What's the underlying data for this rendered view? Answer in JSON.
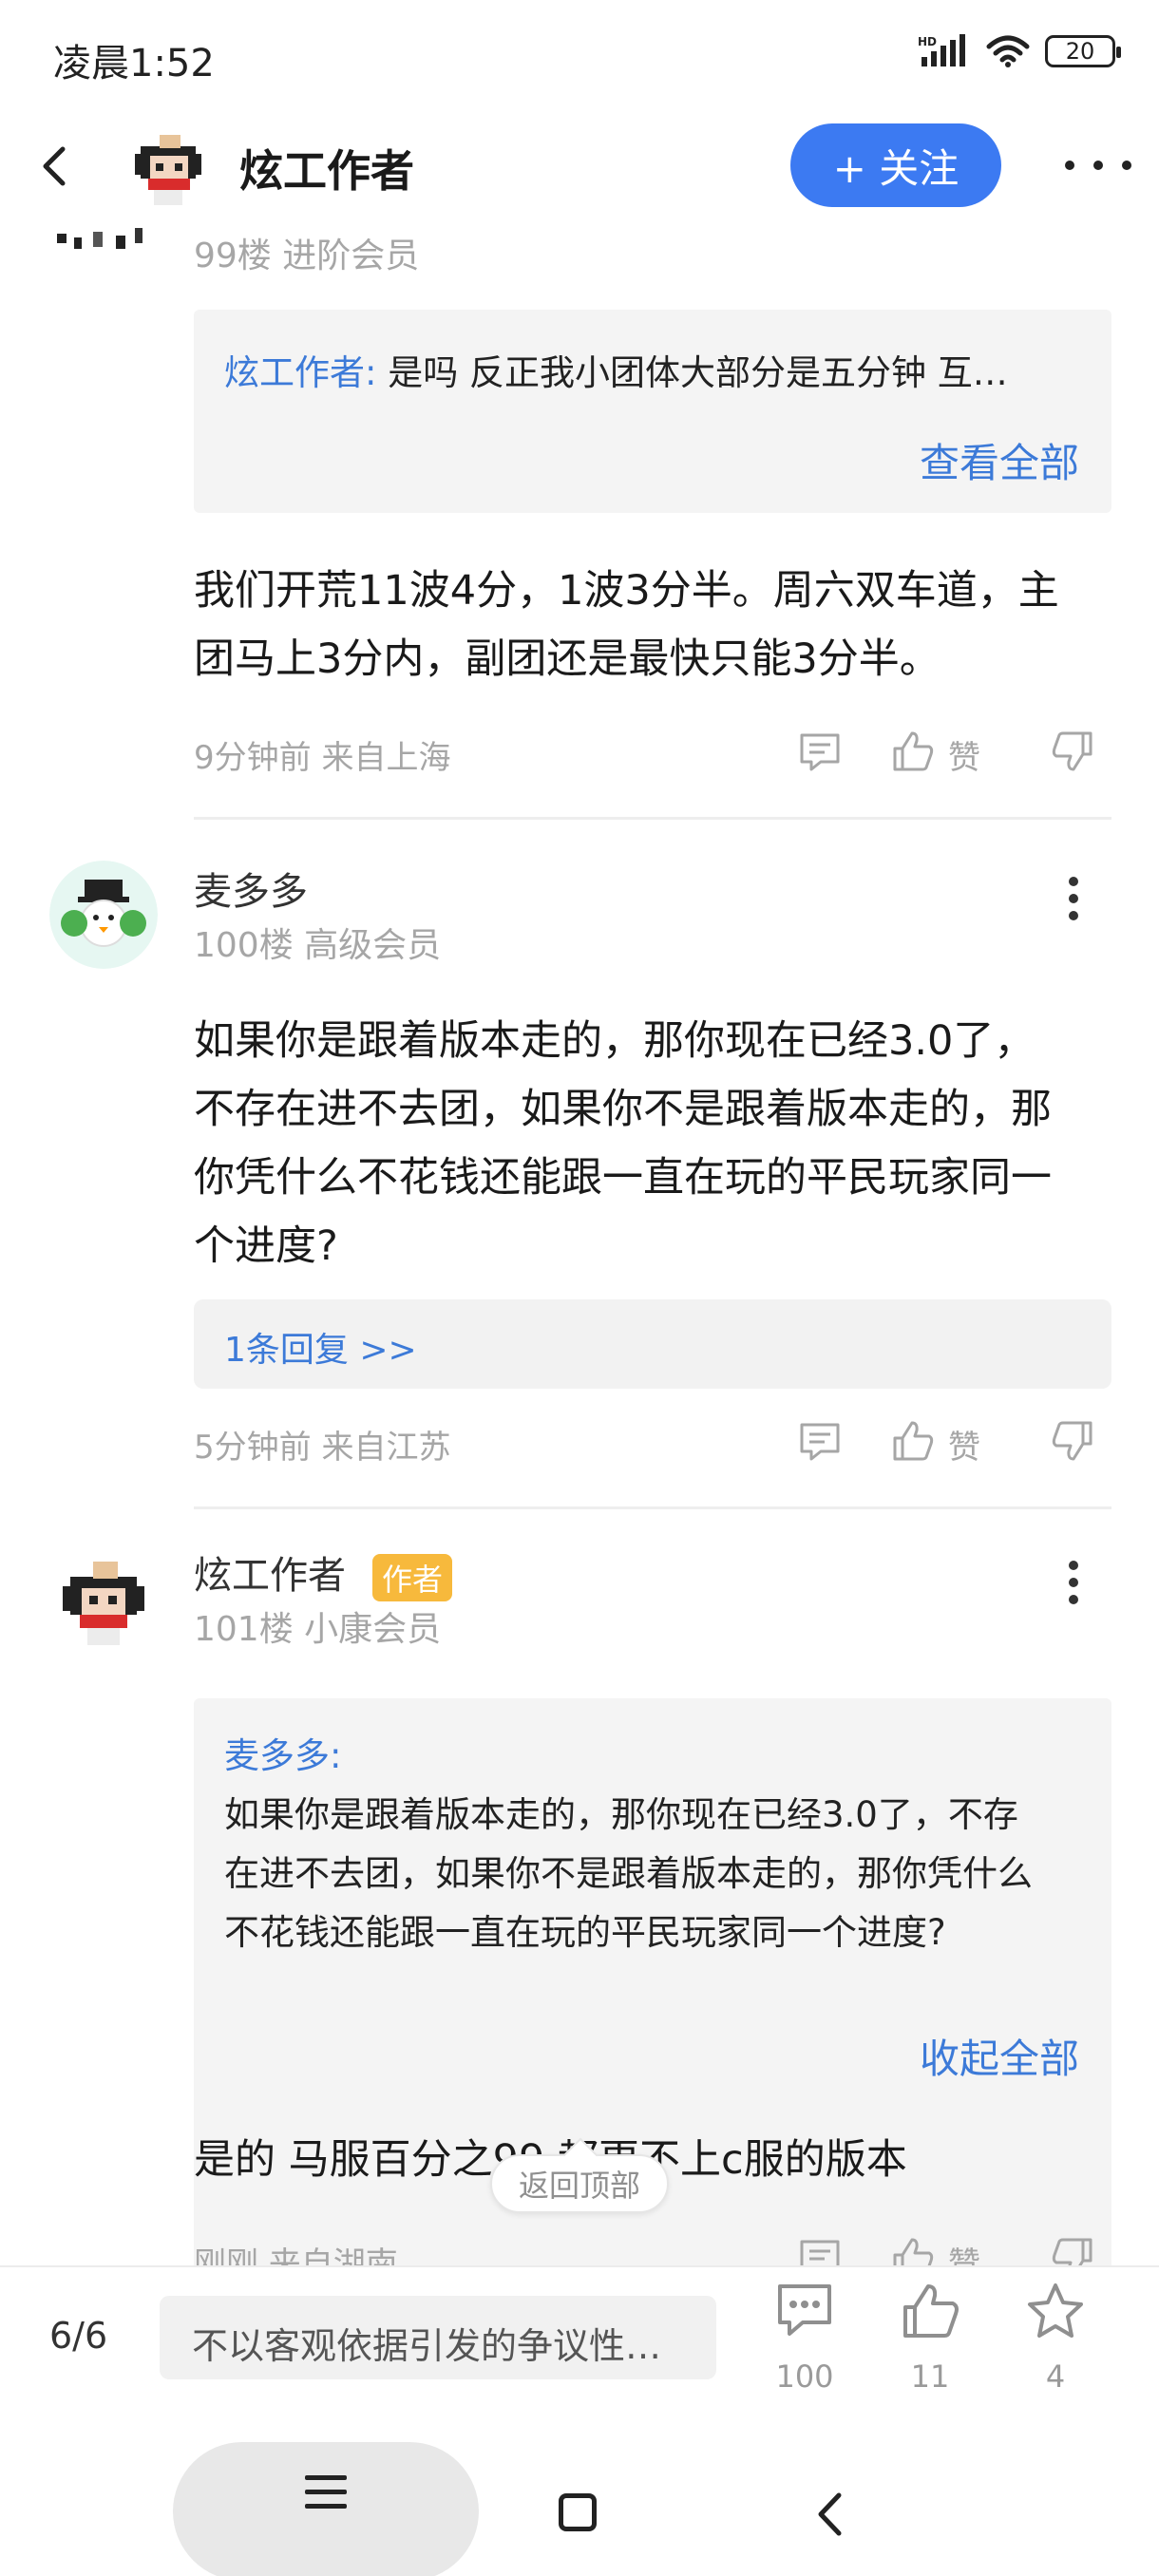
{
  "status_bar": {
    "time": "凌晨1:52",
    "battery": "20",
    "network": "HD"
  },
  "header": {
    "title": "炫工作者",
    "follow_label": "+ 关注"
  },
  "posts": [
    {
      "floor_meta": "99楼 进阶会员",
      "quote_author": "炫工作者:",
      "quote_text": " 是吗  反正我小团体大部分是五分钟 互…",
      "view_all": "查看全部",
      "body_line1": "我们开荒11波4分，1波3分半。周六双车道，主",
      "body_line2": "团马上3分内，副团还是最快只能3分半。",
      "time": "9分钟前 来自上海",
      "like_label": "赞"
    },
    {
      "name": "麦多多",
      "floor_meta": "100楼 高级会员",
      "body_line1": "如果你是跟着版本走的，那你现在已经3.0了，",
      "body_line2": "不存在进不去团，如果你不是跟着版本走的，那",
      "body_line3": "你凭什么不花钱还能跟一直在玩的平民玩家同一",
      "body_line4": "个进度?",
      "replies": "1条回复 >>",
      "time": "5分钟前 来自江苏",
      "like_label": "赞"
    },
    {
      "name": "炫工作者",
      "badge": "作者",
      "floor_meta": "101楼 小康会员",
      "quote_author": "麦多多:",
      "quote_line1": "如果你是跟着版本走的，那你现在已经3.0了，不存",
      "quote_line2": "在进不去团，如果你不是跟着版本走的，那你凭什么",
      "quote_line3": "不花钱还能跟一直在玩的平民玩家同一个进度?",
      "collapse": "收起全部",
      "body_line1": "是的 马服百分之99 都更不上c服的版本",
      "time": "刚刚 来自湖南",
      "like_label": "赞"
    }
  ],
  "back_to_top": "返回顶部",
  "bottom_bar": {
    "page": "6/6",
    "input_placeholder": "不以客观依据引发的争议性…",
    "comments": "100",
    "likes": "11",
    "favorites": "4"
  },
  "colors": {
    "accent": "#3c7af2",
    "link": "#3c7ad8",
    "badge": "#f7b93c"
  }
}
